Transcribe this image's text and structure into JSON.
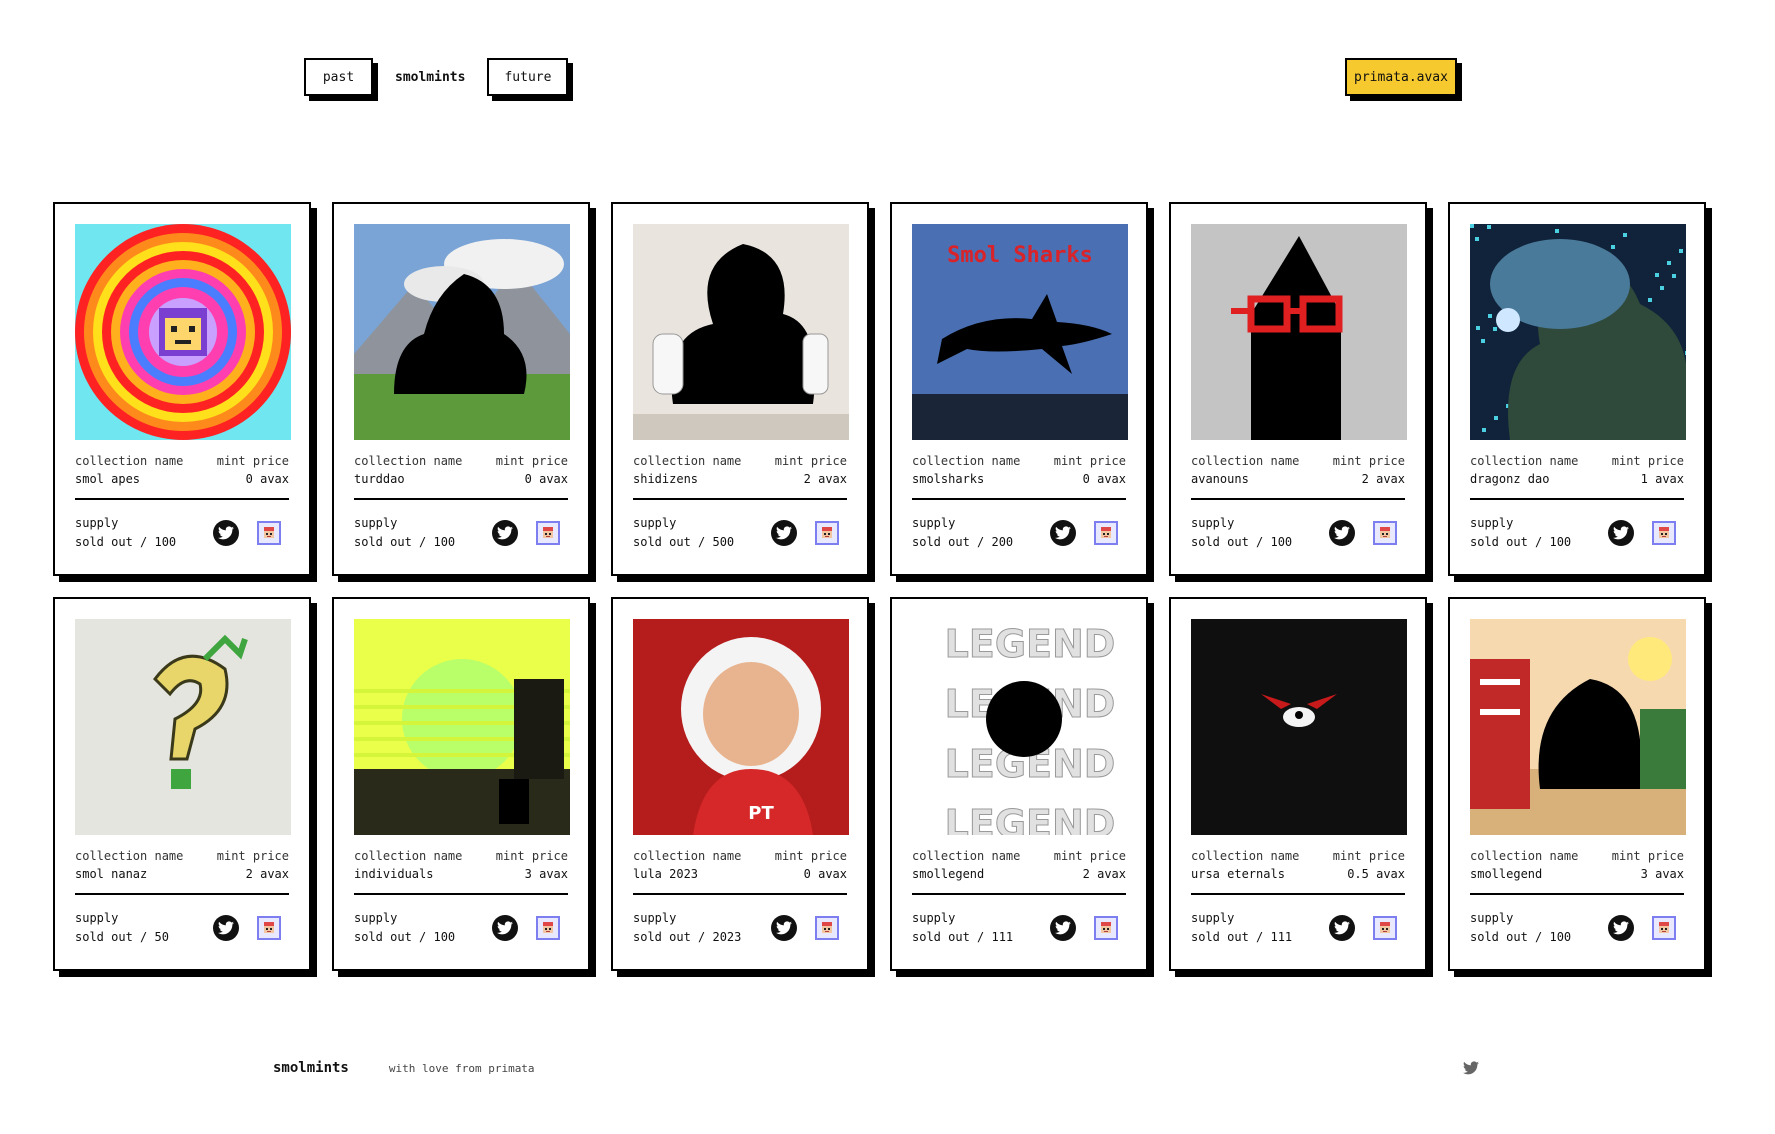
{
  "nav": {
    "past_label": "past",
    "current_label": "smolmints",
    "future_label": "future"
  },
  "wallet": {
    "label": "primata.avax",
    "color": "#f6c92e"
  },
  "card_labels": {
    "collection": "collection name",
    "price": "mint price",
    "supply": "supply"
  },
  "icons": {
    "social": "twitter-icon",
    "market": "marketplace-icon"
  },
  "cards": [
    {
      "name": "smol apes",
      "price": "0 avax",
      "supply": "sold out / 100",
      "art": "smol-apes-art"
    },
    {
      "name": "turddao",
      "price": "0 avax",
      "supply": "sold out / 100",
      "art": "turddao-art"
    },
    {
      "name": "shidizens",
      "price": "2 avax",
      "supply": "sold out / 500",
      "art": "shidizens-art"
    },
    {
      "name": "smolsharks",
      "price": "0 avax",
      "supply": "sold out / 200",
      "art": "smolsharks-art",
      "art_text": "Smol Sharks"
    },
    {
      "name": "avanouns",
      "price": "2 avax",
      "supply": "sold out / 100",
      "art": "avanouns-art"
    },
    {
      "name": "dragonz dao",
      "price": "1 avax",
      "supply": "sold out / 100",
      "art": "dragonz-dao-art"
    },
    {
      "name": "smol nanaz",
      "price": "2 avax",
      "supply": "sold out / 50",
      "art": "smol-nanaz-art"
    },
    {
      "name": "individuals",
      "price": "3 avax",
      "supply": "sold out / 100",
      "art": "individuals-art"
    },
    {
      "name": "lula 2023",
      "price": "0 avax",
      "supply": "sold out / 2023",
      "art": "lula-2023-art",
      "art_text": "PT"
    },
    {
      "name": "smollegend",
      "price": "2 avax",
      "supply": "sold out / 111",
      "art": "smollegend-art",
      "art_text": "LEGEND"
    },
    {
      "name": "ursa eternals",
      "price": "0.5 avax",
      "supply": "sold out / 111",
      "art": "ursa-eternals-art"
    },
    {
      "name": "smollegend",
      "price": "3 avax",
      "supply": "sold out / 100",
      "art": "smollegend-farm-art"
    }
  ],
  "footer": {
    "brand": "smolmints",
    "tagline": "with love from primata"
  }
}
